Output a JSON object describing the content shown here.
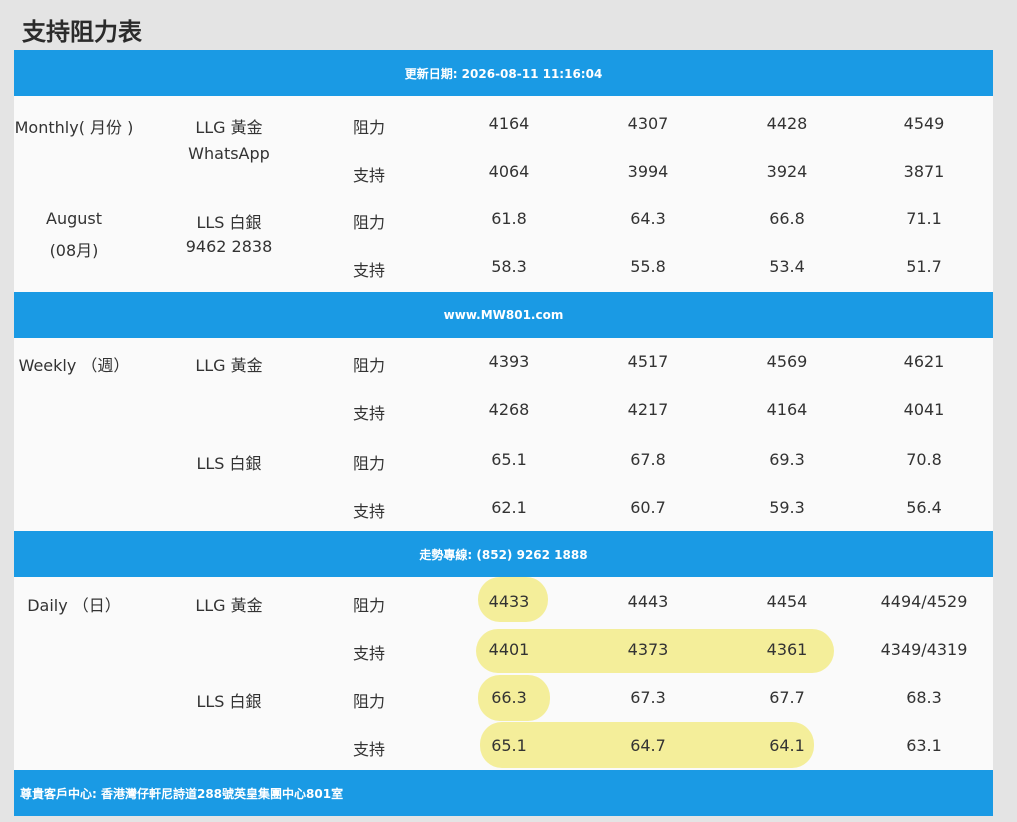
{
  "title": "支持阻力表",
  "bands": {
    "update": "更新日期: 2026-08-11 11:16:04",
    "website": "www.MW801.com",
    "hotline": "走勢專線: (852) 9262 1888",
    "address": "尊貴客戶中心: 香港灣仔軒尼詩道288號英皇集團中心801室"
  },
  "monthly": {
    "period": "Monthly( 月份 )",
    "period_sub": "August",
    "period_sub2": "(08月)",
    "gold_label": "LLG 黃金",
    "gold_sub": "WhatsApp",
    "silver_label": "LLS 白銀",
    "silver_sub": "9462 2838",
    "gold_res": [
      "4164",
      "4307",
      "4428",
      "4549"
    ],
    "gold_sup": [
      "4064",
      "3994",
      "3924",
      "3871"
    ],
    "silver_res": [
      "61.8",
      "64.3",
      "66.8",
      "71.1"
    ],
    "silver_sup": [
      "58.3",
      "55.8",
      "53.4",
      "51.7"
    ]
  },
  "weekly": {
    "period": "Weekly （週）",
    "gold_label": "LLG 黃金",
    "silver_label": "LLS 白銀",
    "gold_res": [
      "4393",
      "4517",
      "4569",
      "4621"
    ],
    "gold_sup": [
      "4268",
      "4217",
      "4164",
      "4041"
    ],
    "silver_res": [
      "65.1",
      "67.8",
      "69.3",
      "70.8"
    ],
    "silver_sup": [
      "62.1",
      "60.7",
      "59.3",
      "56.4"
    ]
  },
  "daily": {
    "period": "Daily （日）",
    "gold_label": "LLG 黃金",
    "silver_label": "LLS 白銀",
    "gold_res": [
      "4433",
      "4443",
      "4454",
      "4494/4529"
    ],
    "gold_sup": [
      "4401",
      "4373",
      "4361",
      "4349/4319"
    ],
    "silver_res": [
      "66.3",
      "67.3",
      "67.7",
      "68.3"
    ],
    "silver_sup": [
      "65.1",
      "64.7",
      "64.1",
      "63.1"
    ]
  },
  "labels": {
    "resistance": "阻力",
    "support": "支持"
  },
  "highlight_color": "#f4ee9a",
  "band_color": "#1a9ae4"
}
